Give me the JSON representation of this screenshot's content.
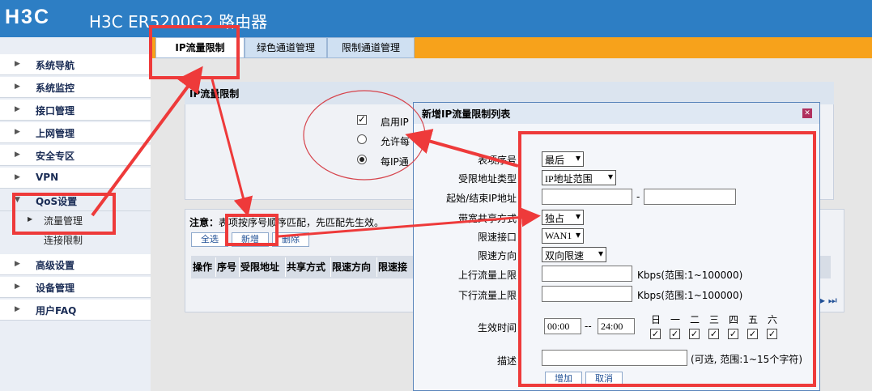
{
  "header": {
    "logo": "H3C",
    "product": "H3C ER5200G2 路由器"
  },
  "sidebar": {
    "items": [
      {
        "label": "系统导航"
      },
      {
        "label": "系统监控"
      },
      {
        "label": "接口管理"
      },
      {
        "label": "上网管理"
      },
      {
        "label": "安全专区"
      },
      {
        "label": "VPN"
      },
      {
        "label": "QoS设置"
      },
      {
        "label": "高级设置"
      },
      {
        "label": "设备管理"
      },
      {
        "label": "用户FAQ"
      }
    ],
    "subitems": [
      {
        "label": "流量管理"
      },
      {
        "label": "连接限制"
      }
    ]
  },
  "tabs": [
    {
      "label": "IP流量限制"
    },
    {
      "label": "绿色通道管理"
    },
    {
      "label": "限制通道管理"
    }
  ],
  "panel": {
    "title": "IP流量限制",
    "opt1": "启用IP",
    "opt2": "允许每",
    "opt3": "每IP通"
  },
  "list": {
    "note": "注意：表项按序号顺序匹配，先匹配先生效。",
    "note_bold": "注意：",
    "note_rest": "表项按序号顺序匹配，先匹配先生效。",
    "btn_all": "全选",
    "btn_new": "新增",
    "btn_delete": "删除",
    "columns": [
      "操作",
      "序号",
      "受限地址",
      "共享方式",
      "限速方向",
      "限速接"
    ]
  },
  "dialog": {
    "title": "新增IP流量限制列表",
    "labels": {
      "seq": "表项序号：",
      "addr_type": "受限地址类型：",
      "ip_range": "起始/结束IP地址：",
      "share": "带宽共享方式：",
      "iface": "限速接口：",
      "direction": "限速方向：",
      "up": "上行流量上限：",
      "down": "下行流量上限：",
      "time": "生效时间：",
      "desc": "描述："
    },
    "values": {
      "seq": "最后",
      "addr_type": "IP地址范围",
      "share": "独占",
      "iface": "WAN1",
      "direction": "双向限速",
      "time_start": "00:00",
      "time_end": "24:00",
      "ip_dash": "-",
      "time_dash": "--"
    },
    "units": {
      "up": "Kbps(范围:1~100000)",
      "down": "Kbps(范围:1~100000)",
      "desc": "(可选, 范围:1~15个字符)"
    },
    "days": [
      "日",
      "一",
      "二",
      "三",
      "四",
      "五",
      "六"
    ],
    "days_checked": [
      true,
      true,
      true,
      true,
      true,
      true,
      true
    ],
    "btn_add": "增加",
    "btn_cancel": "取消"
  },
  "pager": "▸ ⏭",
  "colors": {
    "header": "#2d7ec4",
    "accent": "#f7a21b",
    "annotation": "#ee3a3a"
  }
}
